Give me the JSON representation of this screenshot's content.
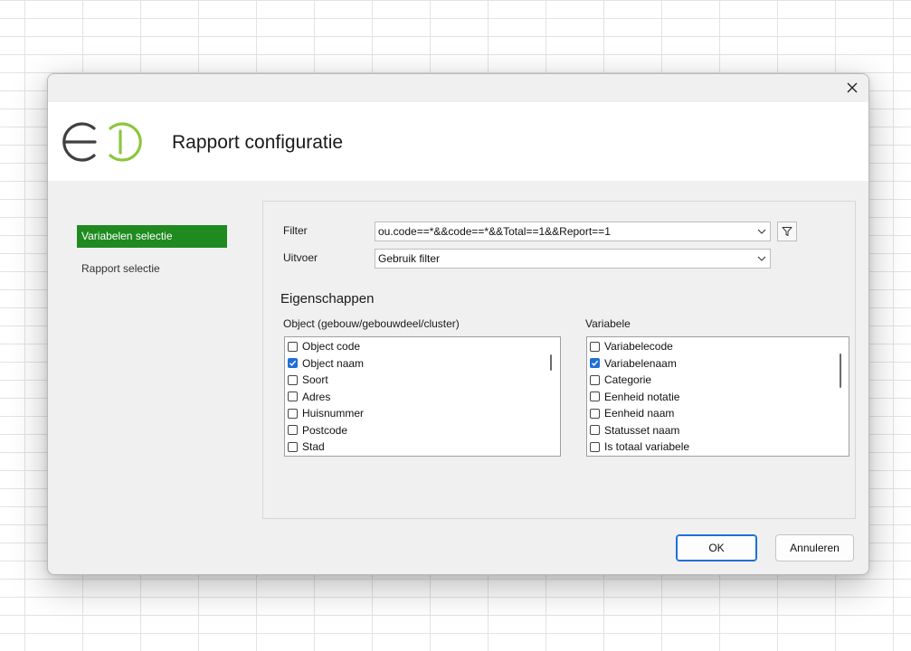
{
  "window": {
    "title": "Rapport configuratie"
  },
  "sidebar": {
    "items": [
      {
        "label": "Variabelen selectie",
        "active": true
      },
      {
        "label": "Rapport selectie",
        "active": false
      }
    ]
  },
  "filter": {
    "label": "Filter",
    "value": "ou.code==*&&code==*&&Total==1&&Report==1"
  },
  "output": {
    "label": "Uitvoer",
    "value": "Gebruik filter"
  },
  "properties": {
    "title": "Eigenschappen",
    "object_list": {
      "label": "Object (gebouw/gebouwdeel/cluster)",
      "items": [
        {
          "label": "Object code",
          "checked": false
        },
        {
          "label": "Object naam",
          "checked": true
        },
        {
          "label": "Soort",
          "checked": false
        },
        {
          "label": "Adres",
          "checked": false
        },
        {
          "label": "Huisnummer",
          "checked": false
        },
        {
          "label": "Postcode",
          "checked": false
        },
        {
          "label": "Stad",
          "checked": false
        }
      ]
    },
    "variable_list": {
      "label": "Variabele",
      "items": [
        {
          "label": "Variabelecode",
          "checked": false
        },
        {
          "label": "Variabelenaam",
          "checked": true
        },
        {
          "label": "Categorie",
          "checked": false
        },
        {
          "label": "Eenheid notatie",
          "checked": false
        },
        {
          "label": "Eenheid naam",
          "checked": false
        },
        {
          "label": "Statusset naam",
          "checked": false
        },
        {
          "label": "Is totaal variabele",
          "checked": false
        }
      ]
    }
  },
  "buttons": {
    "ok": "OK",
    "cancel": "Annuleren"
  },
  "colors": {
    "accent_green": "#1f8a1f",
    "checkbox_blue": "#1f6fd6",
    "logo_gray": "#404040",
    "logo_green": "#8cc63f"
  },
  "icons": {
    "close": "close-icon",
    "filter": "funnel-icon",
    "dropdown": "chevron-down-icon",
    "check": "checkmark-icon"
  }
}
